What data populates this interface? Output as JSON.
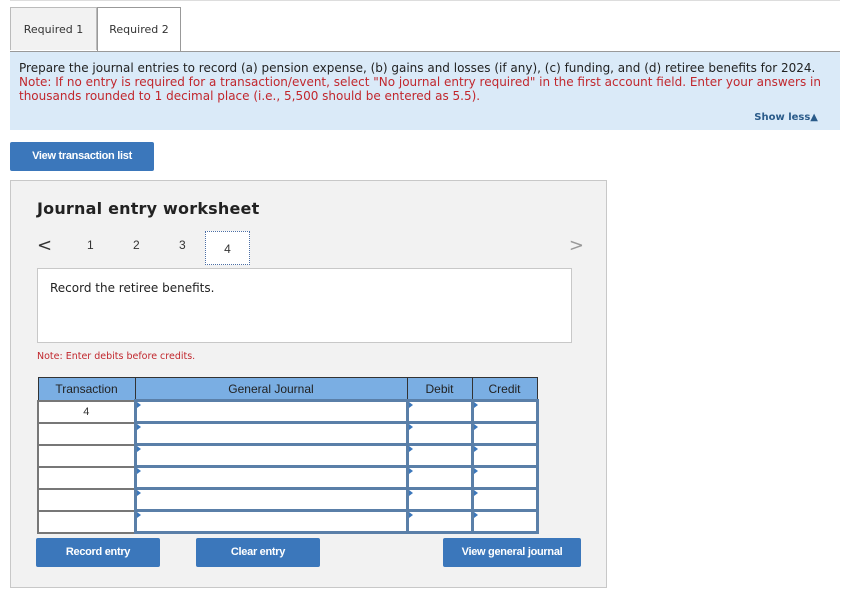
{
  "tabs": [
    {
      "label": "Required 1",
      "active": false
    },
    {
      "label": "Required 2",
      "active": true
    }
  ],
  "instructions": {
    "main": "Prepare the journal entries to record (a) pension expense, (b) gains and losses (if any), (c) funding, and (d) retiree benefits for 2024.",
    "note": "Note: If no entry is required for a transaction/event, select \"No journal entry required\" in the first account field. Enter your answers in thousands rounded to 1 decimal place (i.e., 5,500 should be entered as 5.5).",
    "show_less": "Show less▲"
  },
  "buttons": {
    "view_transaction_list": "View transaction list",
    "record_entry": "Record entry",
    "clear_entry": "Clear entry",
    "view_general_journal": "View general journal"
  },
  "worksheet": {
    "title": "Journal entry worksheet",
    "pager": {
      "prev": "<",
      "next": ">",
      "pages": [
        "1",
        "2",
        "3",
        "4"
      ],
      "current": "4"
    },
    "description": "Record the retiree benefits.",
    "note": "Note: Enter debits before credits.",
    "table": {
      "headers": [
        "Transaction",
        "General Journal",
        "Debit",
        "Credit"
      ],
      "rows": [
        {
          "transaction": "4",
          "account": "",
          "debit": "",
          "credit": ""
        },
        {
          "transaction": "",
          "account": "",
          "debit": "",
          "credit": ""
        },
        {
          "transaction": "",
          "account": "",
          "debit": "",
          "credit": ""
        },
        {
          "transaction": "",
          "account": "",
          "debit": "",
          "credit": ""
        },
        {
          "transaction": "",
          "account": "",
          "debit": "",
          "credit": ""
        },
        {
          "transaction": "",
          "account": "",
          "debit": "",
          "credit": ""
        }
      ]
    }
  }
}
